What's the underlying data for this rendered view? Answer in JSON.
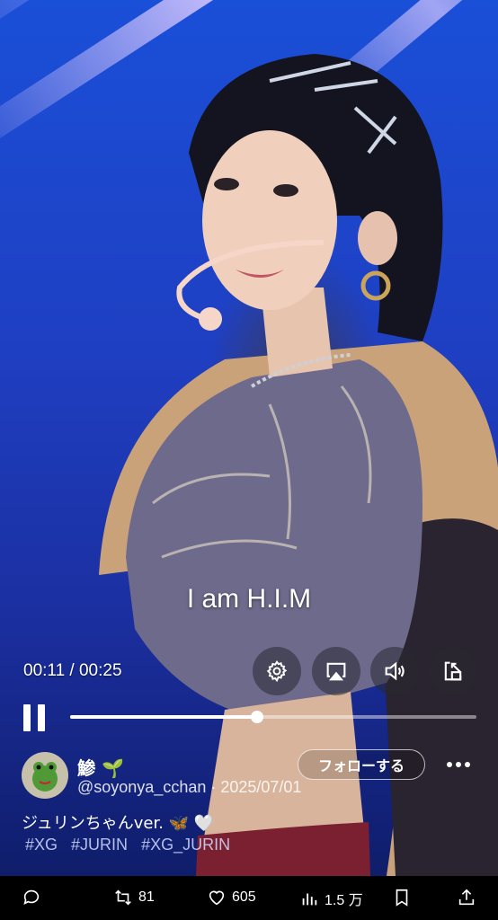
{
  "video": {
    "subtitle": "I am H.I.M",
    "time_display": "00:11 / 00:25",
    "progress": 0.46
  },
  "controls": {
    "settings_icon": "gear-icon",
    "airplay_icon": "airplay-icon",
    "volume_icon": "speaker-icon",
    "exit_icon": "minimize-icon",
    "pause_icon": "pause-icon"
  },
  "author": {
    "name": "鯵 🌱",
    "handle_date": "@soyonya_cchan · 2025/07/01",
    "follow_label": "フォローする"
  },
  "post": {
    "caption": "ジュリンちゃんver. 🦋 🤍",
    "hashtags": [
      "#XG",
      "#JURIN",
      "#XG_JURIN"
    ]
  },
  "actions": {
    "retweets": "81",
    "likes": "605",
    "views": "1.5 万"
  }
}
